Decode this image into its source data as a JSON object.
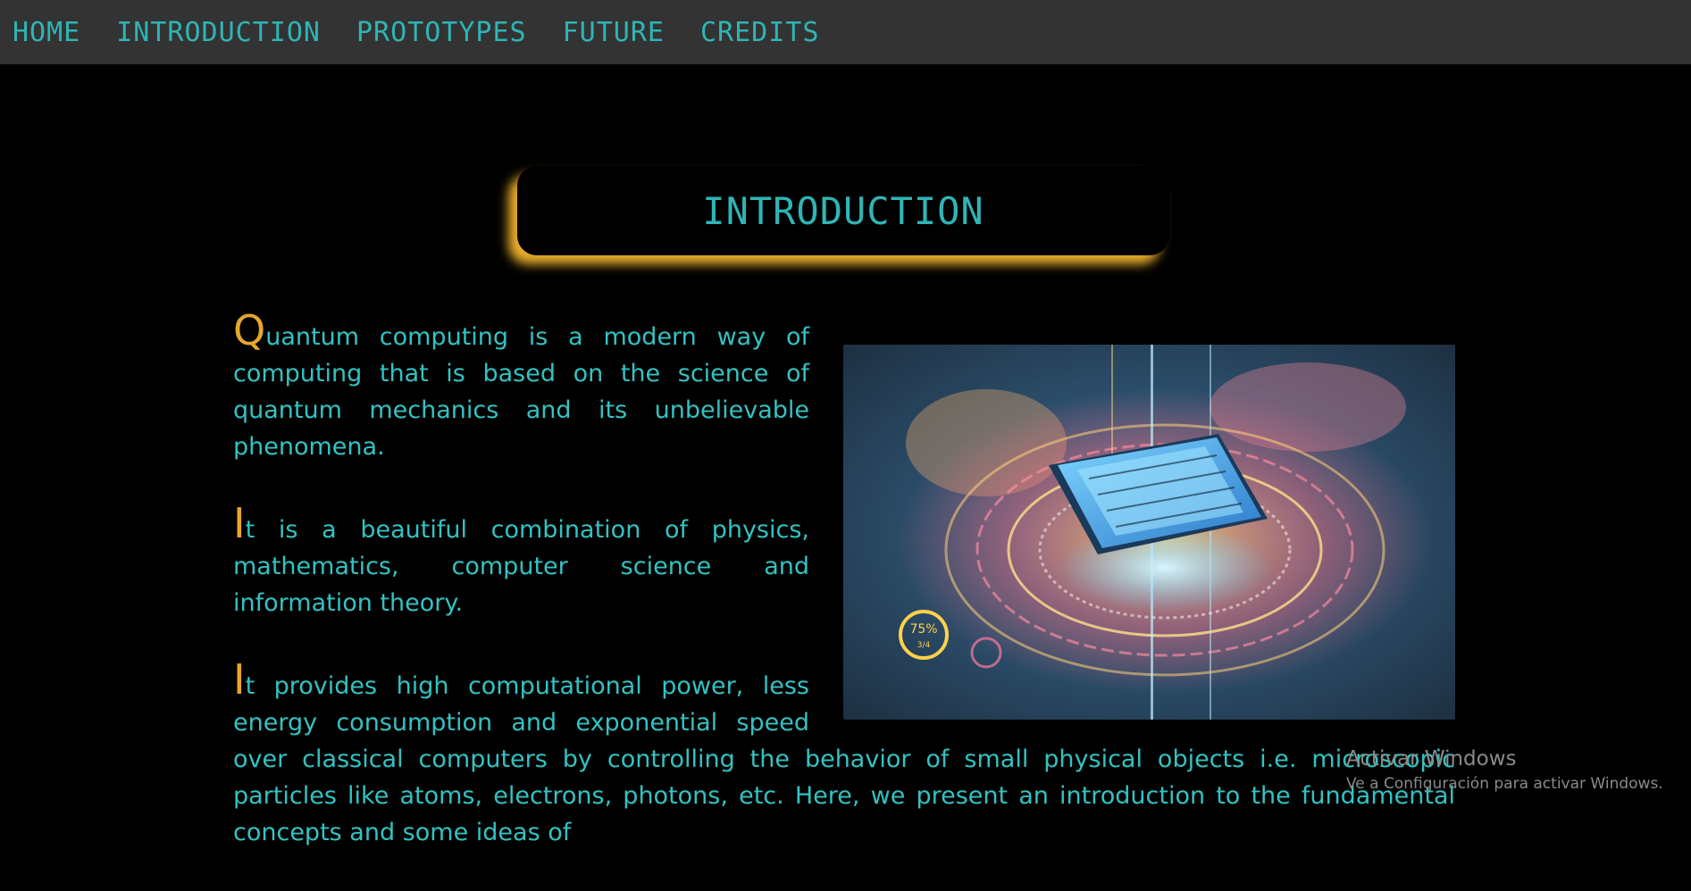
{
  "nav": {
    "items": [
      {
        "label": "HOME"
      },
      {
        "label": "INTRODUCTION"
      },
      {
        "label": "PROTOTYPES"
      },
      {
        "label": "FUTURE"
      },
      {
        "label": "CREDITS"
      }
    ]
  },
  "section": {
    "title": "INTRODUCTION"
  },
  "image": {
    "badge_percent": "75%",
    "badge_fraction": "3/4"
  },
  "paragraphs": [
    {
      "initial": "Q",
      "text": "uantum computing is a modern way of computing that is based on the science of quantum mechanics and its unbelievable phenomena."
    },
    {
      "initial": "I",
      "text": "t is a beautiful combination of physics, mathematics, computer science and information theory."
    },
    {
      "initial": "I",
      "text": "t provides high computational power, less energy consumption and exponential speed over classical computers by controlling the behavior of small physical objects i.e. microscopic particles like atoms, electrons, photons, etc. Here, we present an introduction to the fundamental concepts and some ideas of"
    }
  ],
  "watermark": {
    "title": "Activar Windows",
    "subtitle": "Ve a Configuración para activar Windows."
  },
  "colors": {
    "nav_bg": "#333333",
    "accent_teal": "#2fb5b5",
    "dropcap_gold": "#e6a72a",
    "title_glow": "#f5b82d",
    "page_bg": "#000000"
  }
}
